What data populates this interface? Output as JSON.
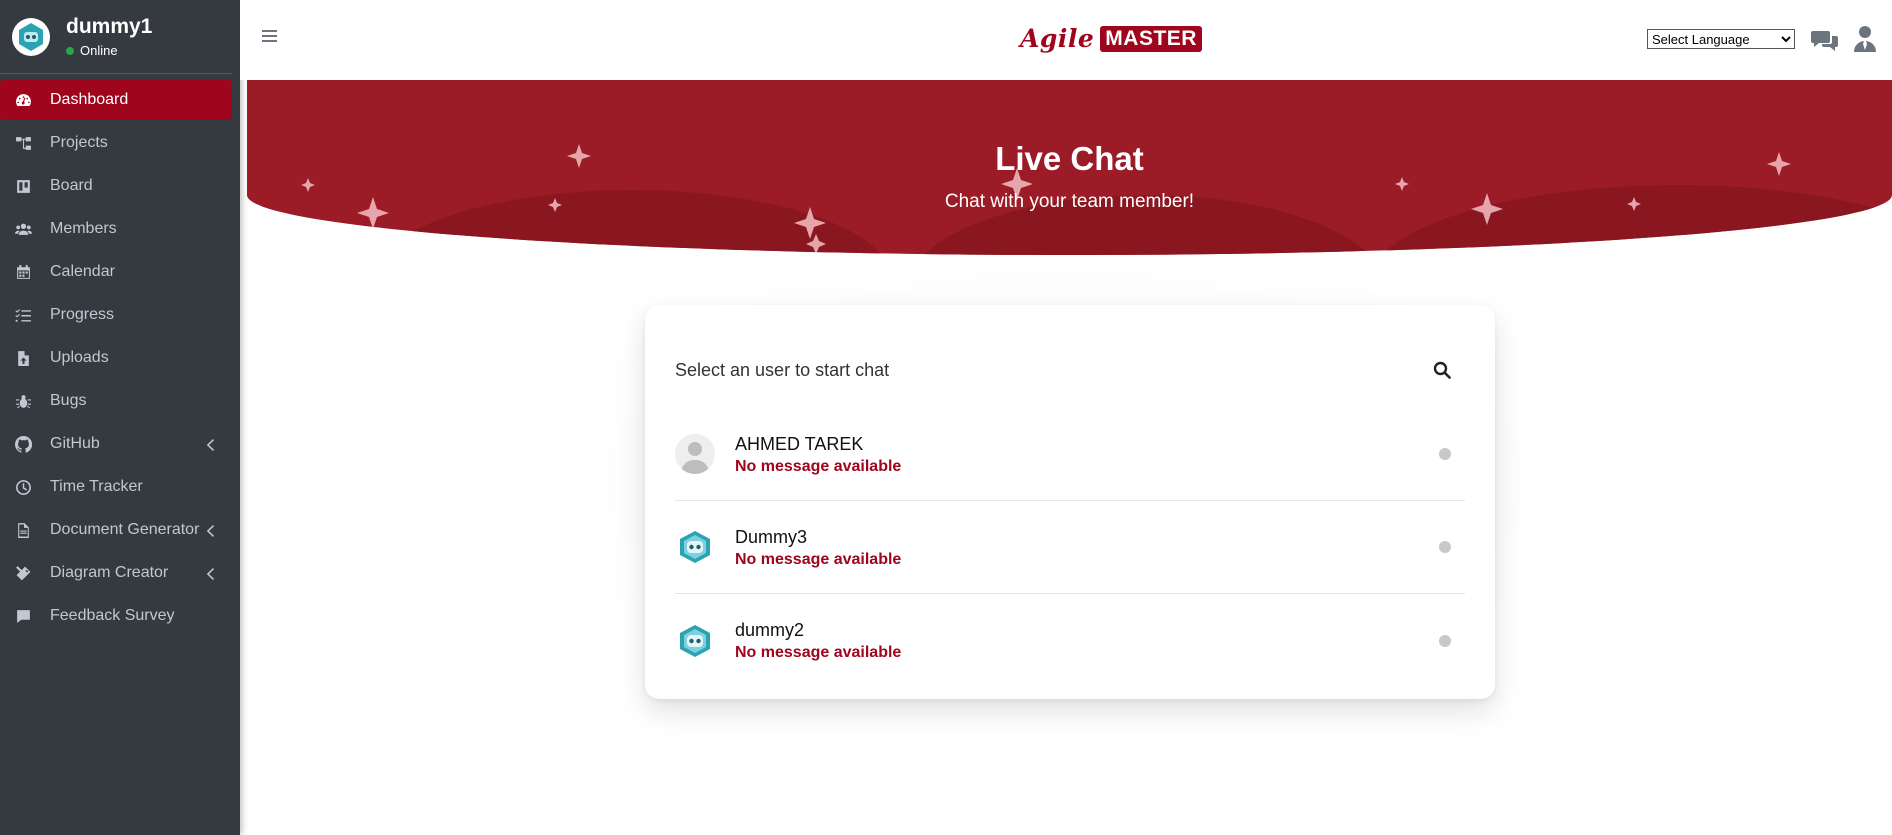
{
  "user": {
    "name": "dummy1",
    "status": "Online"
  },
  "sidebar": {
    "items": [
      {
        "label": "Dashboard",
        "icon": "dashboard-icon",
        "active": true
      },
      {
        "label": "Projects",
        "icon": "sitemap-icon"
      },
      {
        "label": "Board",
        "icon": "board-icon"
      },
      {
        "label": "Members",
        "icon": "users-icon"
      },
      {
        "label": "Calendar",
        "icon": "calendar-icon"
      },
      {
        "label": "Progress",
        "icon": "tasks-icon"
      },
      {
        "label": "Uploads",
        "icon": "file-upload-icon"
      },
      {
        "label": "Bugs",
        "icon": "bug-icon"
      },
      {
        "label": "GitHub",
        "icon": "github-icon",
        "expandable": true
      },
      {
        "label": "Time Tracker",
        "icon": "clock-icon"
      },
      {
        "label": "Document Generator",
        "icon": "document-icon",
        "expandable": true
      },
      {
        "label": "Diagram Creator",
        "icon": "tools-icon",
        "expandable": true
      },
      {
        "label": "Feedback Survey",
        "icon": "comment-icon"
      }
    ]
  },
  "header": {
    "logo_agile": "Agile",
    "logo_master": "MASTER",
    "language_select": {
      "selected": "Select Language"
    }
  },
  "banner": {
    "title": "Live Chat",
    "subtitle": "Chat with your team member!"
  },
  "chat": {
    "header": "Select an user to start chat",
    "users": [
      {
        "name": "AHMED TAREK",
        "message": "No message available",
        "avatar": "default-user-avatar"
      },
      {
        "name": "Dummy3",
        "message": "No message available",
        "avatar": "robot-avatar"
      },
      {
        "name": "dummy2",
        "message": "No message available",
        "avatar": "robot-avatar"
      }
    ]
  },
  "colors": {
    "brand": "#a0051e",
    "banner": "#9b1b26",
    "sidebar": "#343a40",
    "online": "#28a745"
  }
}
